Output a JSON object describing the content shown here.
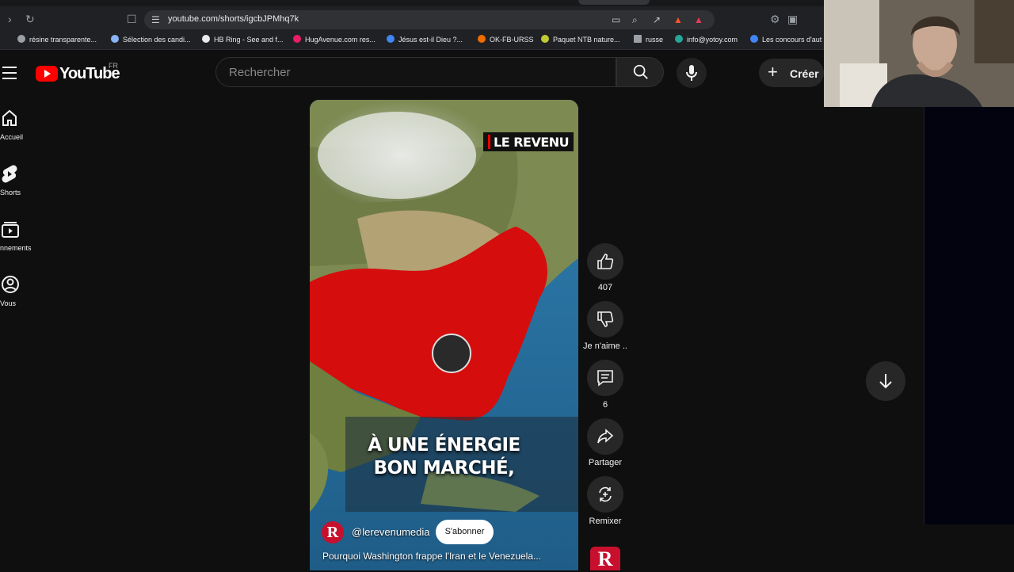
{
  "browser": {
    "url": "youtube.com/shorts/igcbJPMhq7k",
    "bookmarks": [
      {
        "label": "résine transparente...",
        "color": "#9aa0a6"
      },
      {
        "label": "Sélection des candi...",
        "color": "#8ab4f8"
      },
      {
        "label": "HB Ring - See and f...",
        "color": "#e8eaed"
      },
      {
        "label": "HugAvenue.com res...",
        "color": "#e91e63"
      },
      {
        "label": "Jésus est-il Dieu ?...",
        "color": "#4285f4"
      },
      {
        "label": "OK-FB-URSS",
        "color": "#ef6c00"
      },
      {
        "label": "Paquet NTB nature...",
        "color": "#c0ca33"
      },
      {
        "label": "russe",
        "color": "#9aa0a6"
      },
      {
        "label": "info@yotoy.com",
        "color": "#26a69a"
      },
      {
        "label": "Les concours d'aut",
        "color": "#4285f4"
      }
    ]
  },
  "header": {
    "logo_text": "YouTube",
    "region": "FR",
    "search_placeholder": "Rechercher",
    "create_label": "Créer"
  },
  "sidebar": {
    "items": [
      {
        "label": "Accueil",
        "icon": "home-icon"
      },
      {
        "label": "Shorts",
        "icon": "shorts-icon"
      },
      {
        "label": "nnements",
        "icon": "subscriptions-icon"
      },
      {
        "label": "Vous",
        "icon": "you-icon"
      }
    ]
  },
  "video": {
    "brand_badge": "LE REVENU",
    "caption_line1": "À UNE ÉNERGIE",
    "caption_line2": "BON MARCHÉ,",
    "channel_handle": "@lerevenumedia",
    "channel_initial": "R",
    "subscribe_label": "S'abonner",
    "title": "Pourquoi Washington frappe l'Iran et le Venezuela..."
  },
  "actions": {
    "likes": "407",
    "dislike_label": "Je n'aime ..",
    "comments": "6",
    "share_label": "Partager",
    "remix_label": "Remixer"
  },
  "colors": {
    "brand_red": "#ff0000",
    "channel_red": "#c8102e",
    "background": "#0f0f0f"
  }
}
